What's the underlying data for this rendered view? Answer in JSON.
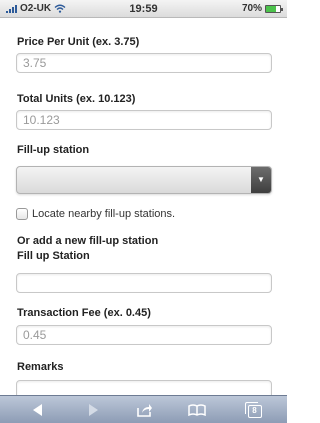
{
  "status_bar": {
    "carrier": "O2-UK",
    "time": "19:59",
    "battery": "70%",
    "battery_level": 0.7
  },
  "form": {
    "price_label": "Price Per Unit (ex. 3.75)",
    "price_placeholder": "3.75",
    "units_label": "Total Units (ex. 10.123)",
    "units_placeholder": "10.123",
    "station_label": "Fill-up station",
    "station_value": "",
    "locate_label": "Locate nearby fill-up stations.",
    "locate_checked": false,
    "new_station_heading": "Or add a new fill-up station",
    "new_station_label": "Fill up Station",
    "new_station_placeholder": "",
    "fee_label": "Transaction Fee (ex. 0.45)",
    "fee_placeholder": "0.45",
    "remarks_label": "Remarks",
    "remarks_placeholder": ""
  },
  "toolbar": {
    "tab_count": "8",
    "icons": [
      "back-arrow-icon",
      "forward-arrow-icon",
      "share-icon",
      "bookmarks-icon",
      "tabs-icon"
    ]
  }
}
